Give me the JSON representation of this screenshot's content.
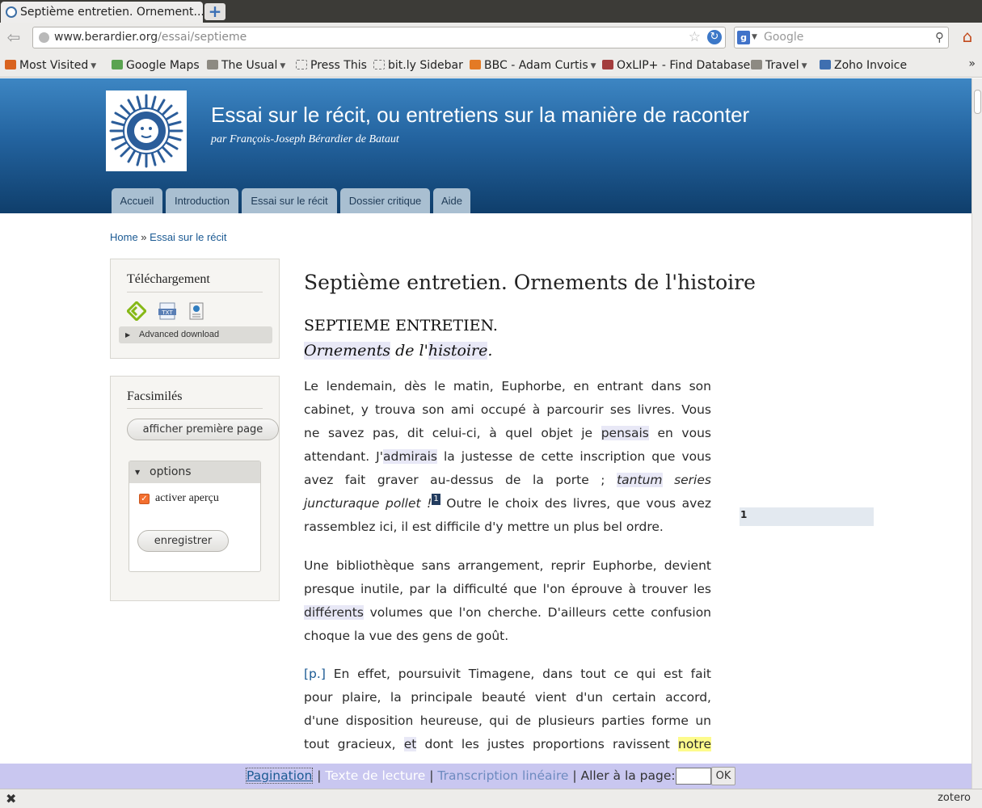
{
  "browser": {
    "tab_title": "Septième entretien. Ornement...",
    "new_tab": "+",
    "url_host": "www.berardier.org",
    "url_path": "/essai/septieme",
    "search_placeholder": "Google",
    "bookmarks": [
      {
        "label": "Most Visited",
        "icon": "folder-icon",
        "color": "#d9631f",
        "caret": true
      },
      {
        "label": "Google Maps",
        "icon": "map-pin-icon",
        "color": "#5aa350",
        "caret": false
      },
      {
        "label": "The Usual",
        "icon": "folder-icon",
        "color": "#8d8a82",
        "caret": true
      },
      {
        "label": "Press This",
        "icon": "page-icon",
        "color": "#777777",
        "caret": false
      },
      {
        "label": "bit.ly Sidebar",
        "icon": "page-icon",
        "color": "#777777",
        "caret": false
      },
      {
        "label": "BBC - Adam Curtis",
        "icon": "rss-icon",
        "color": "#e47a25",
        "caret": true
      },
      {
        "label": "OxLIP+ - Find Database",
        "icon": "oxford-icon",
        "color": "#a33d3d",
        "caret": false
      },
      {
        "label": "Travel",
        "icon": "folder-icon",
        "color": "#8d8a82",
        "caret": true
      },
      {
        "label": "Zoho Invoice",
        "icon": "invoice-icon",
        "color": "#3f6fb0",
        "caret": false
      }
    ]
  },
  "site": {
    "title": "Essai sur le récit, ou entretiens sur la manière de raconter",
    "subtitle": "par François-Joseph Bérardier de Bataut",
    "tabs": [
      "Accueil",
      "Introduction",
      "Essai sur le récit",
      "Dossier critique",
      "Aide"
    ],
    "breadcrumb": {
      "home": "Home",
      "sep": " » ",
      "current": "Essai sur le récit"
    }
  },
  "sidebar": {
    "download": {
      "title": "Téléchargement",
      "advanced": "Advanced download"
    },
    "facsimiles": {
      "title": "Facsimilés",
      "first_page_button": "afficher première page",
      "options_legend": "options",
      "preview_label": "activer aperçu",
      "preview_checked": true,
      "save_button": "enregistrer"
    }
  },
  "content": {
    "node_title": "Septième entretien. Ornements de l'histoire",
    "chapter_head": "SEPTIEME ENTRETIEN.",
    "chapter_sub": {
      "w1": "Ornements",
      "w2": " de l'",
      "w3": "histoire",
      "w4": "."
    },
    "footnote_marker": "1",
    "note_number": "1",
    "para1": {
      "l1": "Le lendemain, dès le matin, Euphorbe, en entrant dans son",
      "l2": "cabinet, y trouva son ami occupé à parcourir ses livres. Vous",
      "l3a": "ne savez pas, dit celui-ci, à quel objet je ",
      "l3b": "pensais",
      "l3c": " en vous",
      "l4a": "attendant. J'",
      "l4b": "admirais",
      "l4c": " la justesse de cette inscription que vous",
      "l5a": "avez fait graver au-dessus de la porte ; ",
      "l5b": "tantum",
      "l5c": " series",
      "l6a": "juncturaque pollet !",
      "l6b": " Outre le choix des livres, que vous avez",
      "l7": "rassemblez ici, il est difficile d'y mettre un plus bel ordre."
    },
    "para2": {
      "l1": "Une bibliothèque sans arrangement, reprir Euphorbe, devient",
      "l2": "presque inutile, par la difficulté que l'on éprouve à trouver les",
      "l3a": "différents",
      "l3b": " volumes que l'on cherche. D'ailleurs cette confusion",
      "l4": "choque la vue des gens de goût."
    },
    "para3": {
      "pag": "[p.]",
      "l1": " En effet, poursuivit Timagene, dans tout ce qui est fait",
      "l2": "pour plaire, la principale beauté vient d'un certain accord,",
      "l3": "d'une disposition heureuse, qui de plusieurs parties forme un",
      "l4a": "tout gracieux, ",
      "l4b": "et",
      "l4c": " dont les justes proportions ravissent ",
      "l4d": "notre"
    }
  },
  "reader_bar": {
    "pagination": "Pagination",
    "sep": " | ",
    "reading_text": "Texte de lecture",
    "linear": "Transcription linéaire",
    "goto": "Aller à la page:",
    "ok": "OK"
  },
  "statusbar": {
    "zotero": "zotero"
  }
}
